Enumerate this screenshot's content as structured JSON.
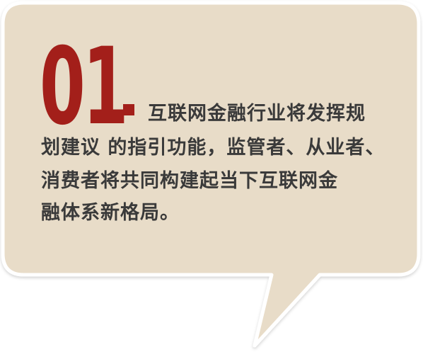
{
  "heading": {
    "number": "01"
  },
  "body": {
    "lines": [
      "互联网金融行业将发挥规",
      "划建议 的指引功能，监管者、从业者、",
      "消费者将共同构建起当下互联网金",
      "融体系新格局。"
    ]
  },
  "colors": {
    "bubble_fill": "#e8dcc8",
    "bubble_border": "#ffffff",
    "accent": "#a31f1a",
    "text": "#3a3a3a"
  }
}
